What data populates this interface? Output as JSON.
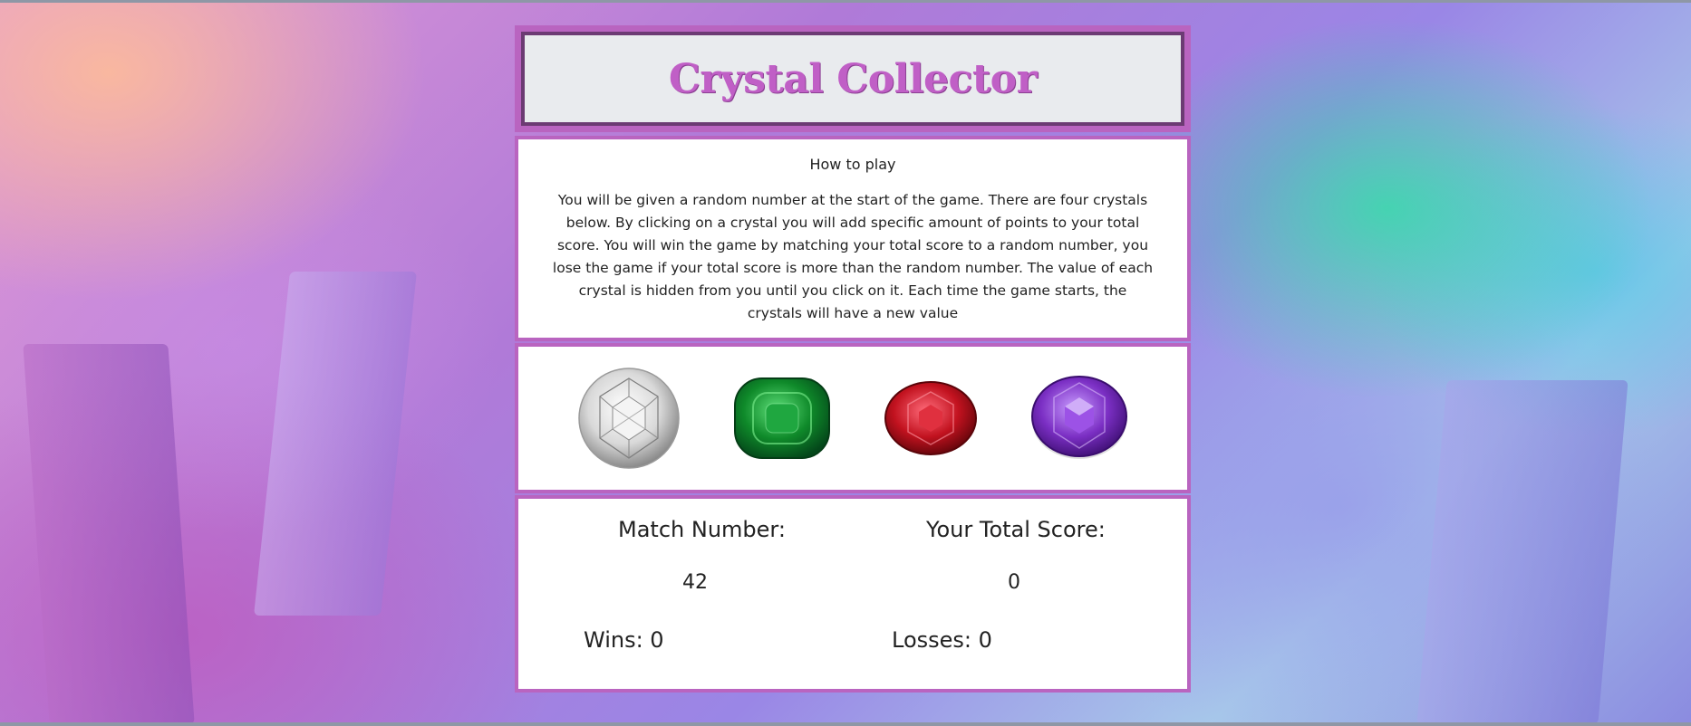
{
  "header": {
    "title": "Crystal Collector"
  },
  "instructions": {
    "heading": "How to play",
    "text": "You will be given a random number at the start of the game. There are four crystals below. By clicking on a crystal you will add specific amount of points to your total score. You will win the game by matching your total score to a random number, you lose the game if your total score is more than the random number. The value of each crystal is hidden from you until you click on it. Each time the game starts, the crystals will have a new value"
  },
  "crystals": [
    {
      "name": "diamond",
      "color": "#e8e8e8"
    },
    {
      "name": "emerald",
      "color": "#0f8a2a"
    },
    {
      "name": "ruby",
      "color": "#c2121f"
    },
    {
      "name": "amethyst",
      "color": "#7b2fc4"
    }
  ],
  "scoreboard": {
    "match_label": "Match Number:",
    "match_value": "42",
    "total_label": "Your Total Score:",
    "total_value": "0",
    "wins_label": "Wins: 0",
    "losses_label": "Losses: 0"
  }
}
